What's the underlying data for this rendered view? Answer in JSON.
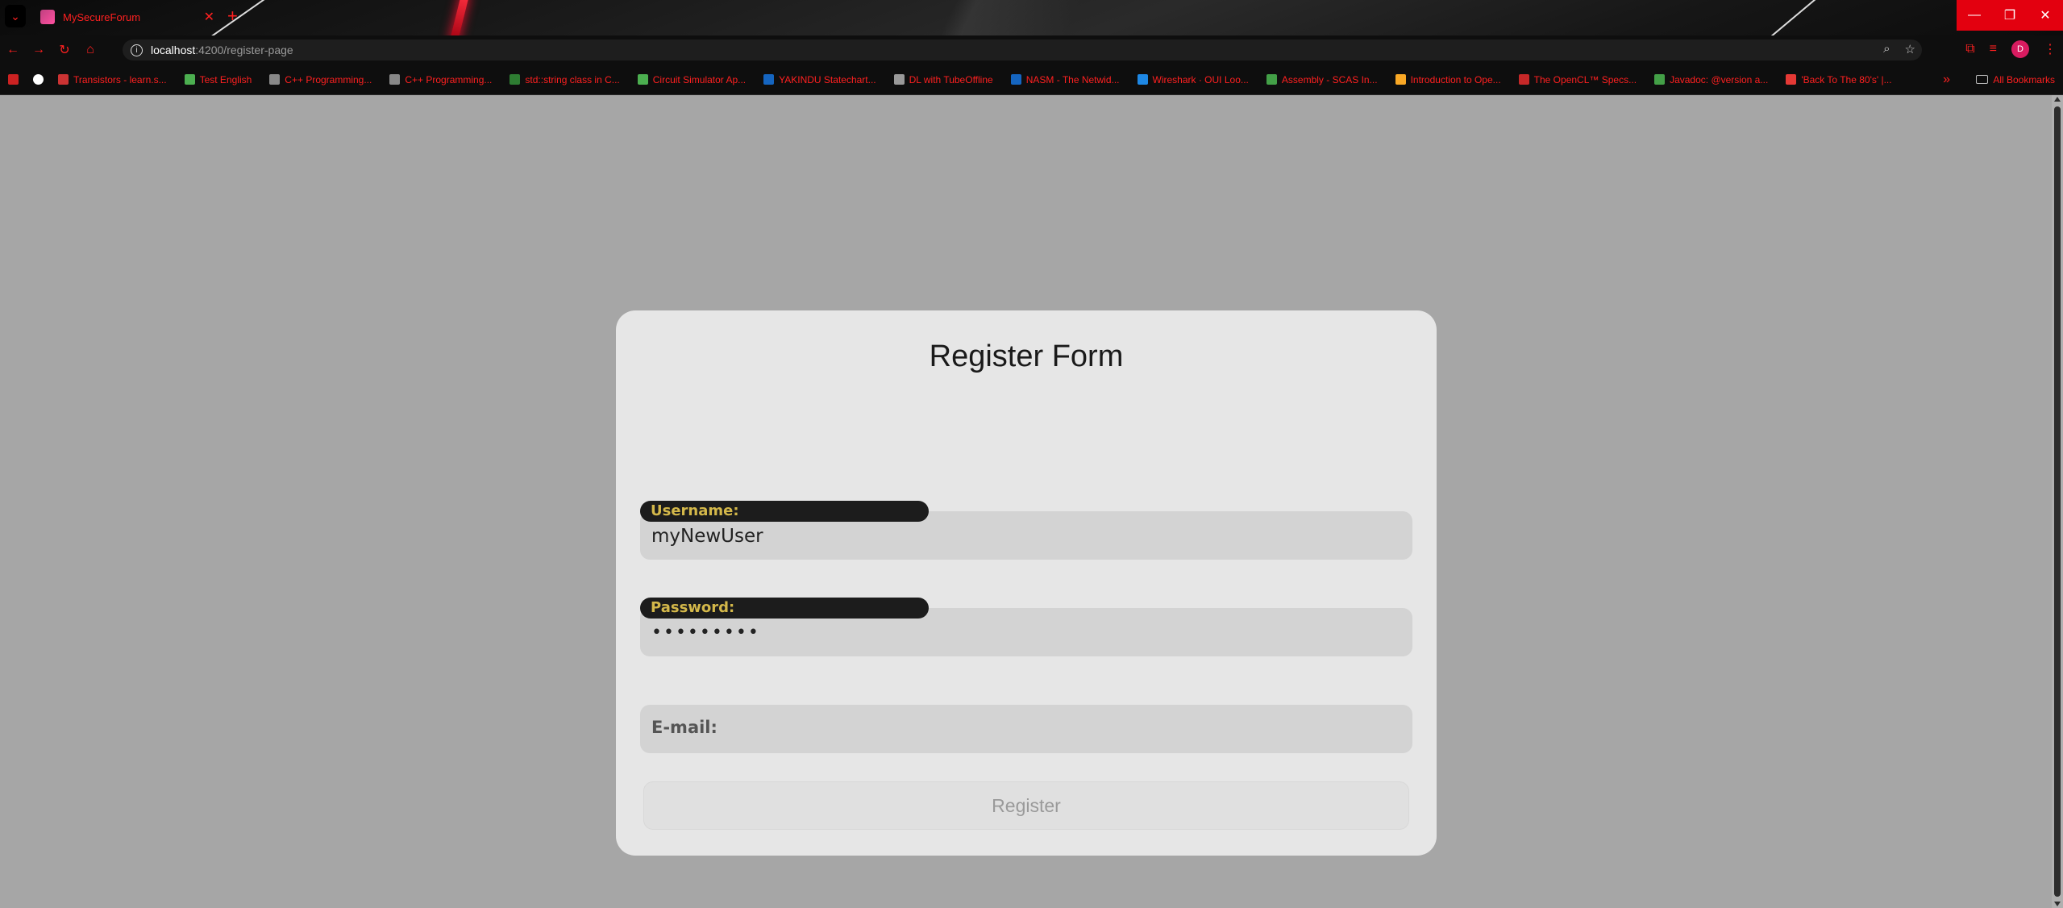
{
  "browser": {
    "tab": {
      "title": "MySecureForum"
    },
    "address": {
      "host": "localhost",
      "path": ":4200/register-page"
    },
    "bookmarks": [
      {
        "label": "Transistors - learn.s...",
        "color": "#cc3333"
      },
      {
        "label": "Test English",
        "color": "#4caf50"
      },
      {
        "label": "C++ Programming...",
        "color": "#888888"
      },
      {
        "label": "C++ Programming...",
        "color": "#888888"
      },
      {
        "label": "std::string class in C...",
        "color": "#2e7d32"
      },
      {
        "label": "Circuit Simulator Ap...",
        "color": "#4caf50"
      },
      {
        "label": "YAKINDU Statechart...",
        "color": "#1565c0"
      },
      {
        "label": "DL with TubeOffline",
        "color": "#999999"
      },
      {
        "label": "NASM - The Netwid...",
        "color": "#1565c0"
      },
      {
        "label": "Wireshark · OUI Loo...",
        "color": "#1e88e5"
      },
      {
        "label": "Assembly - SCAS In...",
        "color": "#43a047"
      },
      {
        "label": "Introduction to Ope...",
        "color": "#f9a825"
      },
      {
        "label": "The OpenCL™ Specs...",
        "color": "#c62828"
      },
      {
        "label": "Javadoc: @version a...",
        "color": "#43a047"
      },
      {
        "label": "'Back To The 80's' |...",
        "color": "#e53935"
      }
    ],
    "all_bookmarks_label": "All Bookmarks",
    "profile_initial": "D"
  },
  "form": {
    "title": "Register Form",
    "username": {
      "label": "Username:",
      "value": "myNewUser"
    },
    "password": {
      "label": "Password:",
      "value": "•••••••••"
    },
    "email": {
      "placeholder": "E-mail:"
    },
    "register_label": "Register"
  },
  "colors": {
    "accent": "#ff2020",
    "badge_text": "#d4b84a",
    "page_bg": "#a6a6a6",
    "card_bg": "#e6e6e6"
  }
}
